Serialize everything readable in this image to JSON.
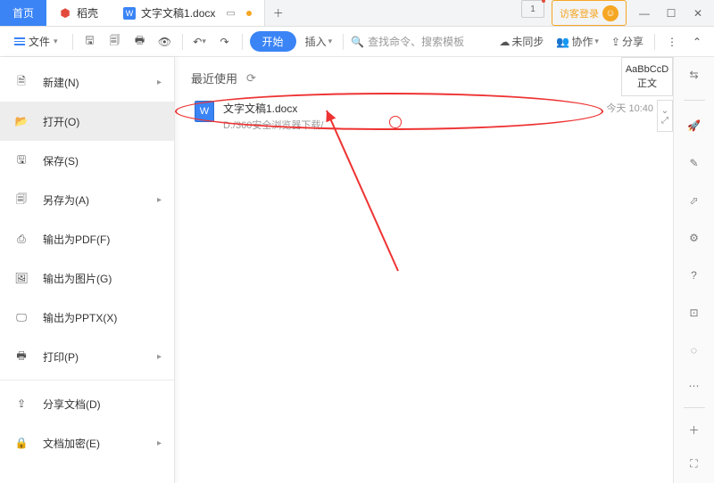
{
  "titlebar": {
    "home": "首页",
    "appTab": "稻壳",
    "docTab": "文字文稿1.docx",
    "pageCount": "1",
    "guestLabel": "访客登录"
  },
  "toolbar": {
    "fileLabel": "文件",
    "startLabel": "开始",
    "insertLabel": "插入",
    "searchPlaceholder": "查找命令、搜索模板",
    "syncLabel": "未同步",
    "collabLabel": "协作",
    "shareLabel": "分享"
  },
  "fileMenu": {
    "new": "新建(N)",
    "open": "打开(O)",
    "save": "保存(S)",
    "saveAs": "另存为(A)",
    "exportPdf": "输出为PDF(F)",
    "exportImg": "输出为图片(G)",
    "exportPptx": "输出为PPTX(X)",
    "print": "打印(P)",
    "shareDoc": "分享文档(D)",
    "encrypt": "文档加密(E)"
  },
  "recent": {
    "header": "最近使用",
    "items": [
      {
        "title": "文字文稿1.docx",
        "path": "D:/360安全浏览器下载/",
        "time": "今天 10:40"
      }
    ]
  },
  "stylePreview": {
    "sample": "AaBbCcD",
    "name": "正文"
  }
}
